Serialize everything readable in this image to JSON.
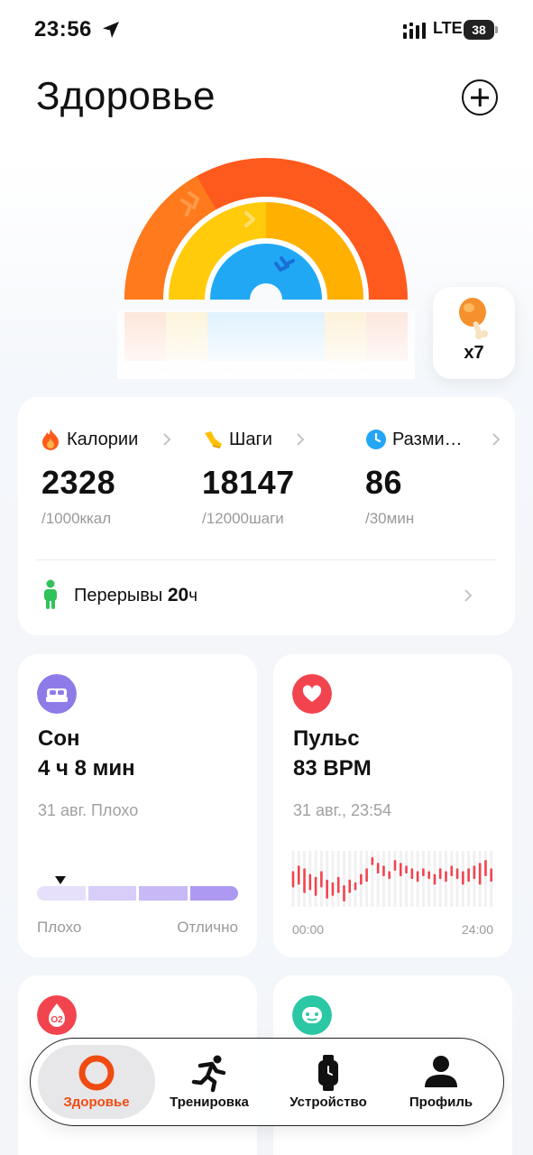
{
  "status_bar": {
    "time": "23:56",
    "network": "LTE",
    "battery": "38"
  },
  "header": {
    "title": "Здоровье"
  },
  "reward": {
    "count": "x7",
    "icon": "drumstick-icon"
  },
  "colors": {
    "calories": "#ff5a1e",
    "steps": "#ffc107",
    "active_minutes": "#23a6f5",
    "sleep": "#8f7be8",
    "pulse": "#f2444e",
    "breaks": "#31c15a",
    "active_tab": "#f04b12"
  },
  "rings": {
    "calories": {
      "value": 2328,
      "goal": 1000
    },
    "steps": {
      "value": 18147,
      "goal": 12000
    },
    "active_minutes": {
      "value": 86,
      "goal": 30
    }
  },
  "activity": {
    "calories": {
      "label": "Калории",
      "value": "2328",
      "goal": "/1000ккал",
      "icon": "flame-icon"
    },
    "steps": {
      "label": "Шаги",
      "value": "18147",
      "goal": "/12000шаги",
      "icon": "shoe-icon"
    },
    "active_minutes": {
      "label": "Разми…",
      "value": "86",
      "goal": "/30мин",
      "icon": "clock-icon"
    },
    "breaks": {
      "label": "Перерывы",
      "value": "20",
      "unit": "ч",
      "icon": "standing-person-icon"
    }
  },
  "sleep": {
    "title": "Сон",
    "value": "4 ч 8 мин",
    "subtitle": "31 авг. Плохо",
    "scale_min": "Плохо",
    "scale_max": "Отлично",
    "quality_level": 0.12,
    "icon": "bed-icon"
  },
  "pulse": {
    "title": "Пульс",
    "value": "83 BPM",
    "subtitle": "31 авг., 23:54",
    "axis_start": "00:00",
    "axis_end": "24:00",
    "icon": "heart-icon"
  },
  "lower_tiles": {
    "oxygen_icon": "o2-icon",
    "mood_icon": "mood-icon"
  },
  "tabs": [
    {
      "label": "Здоровье",
      "icon": "health-ring-icon",
      "active": true
    },
    {
      "label": "Тренировка",
      "icon": "running-icon",
      "active": false
    },
    {
      "label": "Устройство",
      "icon": "watch-icon",
      "active": false
    },
    {
      "label": "Профиль",
      "icon": "person-icon",
      "active": false
    }
  ]
}
